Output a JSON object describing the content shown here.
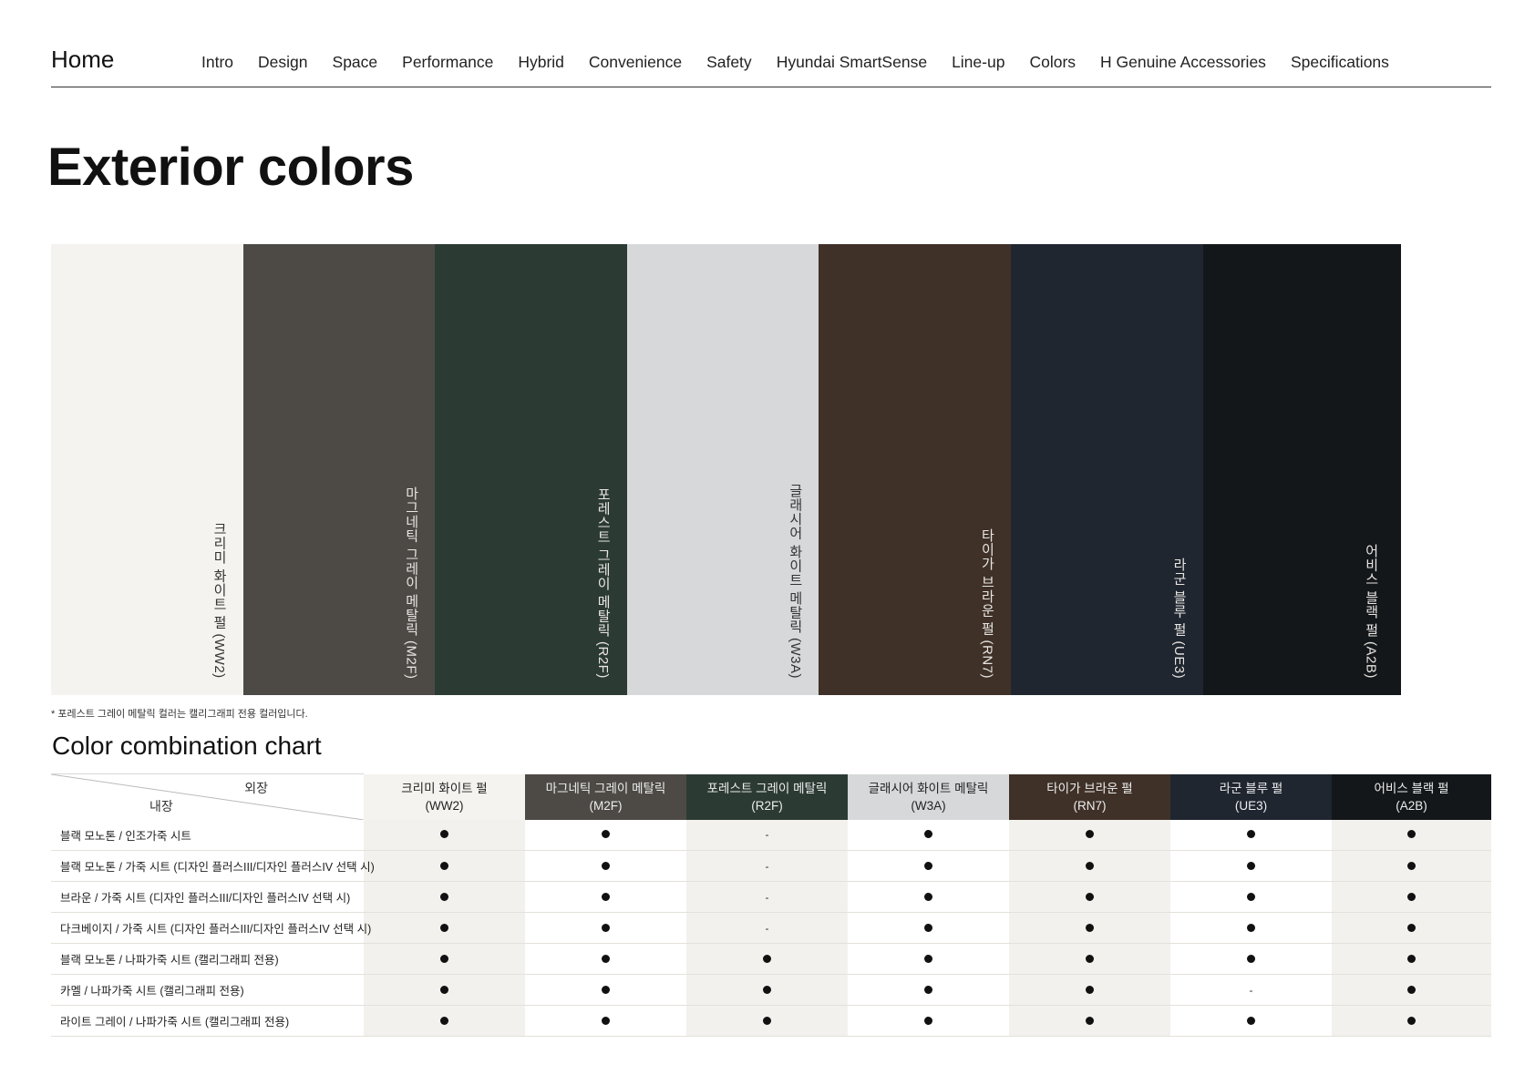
{
  "nav": {
    "home": "Home",
    "items": [
      "Intro",
      "Design",
      "Space",
      "Performance",
      "Hybrid",
      "Convenience",
      "Safety",
      "Hyundai SmartSense",
      "Line-up",
      "Colors",
      "H Genuine Accessories",
      "Specifications"
    ]
  },
  "title": "Exterior colors",
  "swatches": [
    {
      "label": "크리미 화이트 펄 (WW2)",
      "color": "#f4f3ef",
      "text_color": "#333333"
    },
    {
      "label": "마그네틱 그레이 메탈릭 (M2F)",
      "color": "#4d4a46",
      "text_color": "#e8e6e2"
    },
    {
      "label": "포레스트 그레이 메탈릭 (R2F)",
      "color": "#2c3a34",
      "text_color": "#e8e6e2"
    },
    {
      "label": "글래시어 화이트 메탈릭 (W3A)",
      "color": "#d6d8d9",
      "text_color": "#333333"
    },
    {
      "label": "타이가 브라운 펄 (RN7)",
      "color": "#3f3128",
      "text_color": "#e8e6e2"
    },
    {
      "label": "라군 블루 펄 (UE3)",
      "color": "#1f2630",
      "text_color": "#e8e6e2"
    },
    {
      "label": "어비스 블랙 펄 (A2B)",
      "color": "#13171a",
      "text_color": "#e8e6e2"
    }
  ],
  "footnote": "* 포레스트 그레이 메탈릭 컬러는 캘리그래피 전용 컬러입니다.",
  "chart": {
    "title": "Color combination chart",
    "corner_exterior": "외장",
    "corner_interior": "내장",
    "columns": [
      {
        "name": "크리미 화이트 펄",
        "code": "(WW2)",
        "bg": "#f4f3ef",
        "fg": "#222222",
        "shade": true
      },
      {
        "name": "마그네틱 그레이 메탈릭",
        "code": "(M2F)",
        "bg": "#4d4a46",
        "fg": "#eeeeee",
        "shade": false
      },
      {
        "name": "포레스트 그레이 메탈릭",
        "code": "(R2F)",
        "bg": "#2c3a34",
        "fg": "#eeeeee",
        "shade": true
      },
      {
        "name": "글래시어 화이트 메탈릭",
        "code": "(W3A)",
        "bg": "#d6d8d9",
        "fg": "#222222",
        "shade": false
      },
      {
        "name": "타이가 브라운 펄",
        "code": "(RN7)",
        "bg": "#3f3128",
        "fg": "#eeeeee",
        "shade": true
      },
      {
        "name": "라군 블루 펄",
        "code": "(UE3)",
        "bg": "#1f2630",
        "fg": "#eeeeee",
        "shade": false
      },
      {
        "name": "어비스 블랙 펄",
        "code": "(A2B)",
        "bg": "#13171a",
        "fg": "#eeeeee",
        "shade": true
      }
    ],
    "rows": [
      {
        "label": "블랙 모노톤 / 인조가죽 시트",
        "values": [
          "●",
          "●",
          "-",
          "●",
          "●",
          "●",
          "●"
        ]
      },
      {
        "label": "블랙 모노톤 / 가죽 시트 (디자인 플러스III/디자인 플러스IV 선택 시)",
        "values": [
          "●",
          "●",
          "-",
          "●",
          "●",
          "●",
          "●"
        ]
      },
      {
        "label": "브라운 / 가죽 시트 (디자인 플러스III/디자인 플러스IV 선택 시)",
        "values": [
          "●",
          "●",
          "-",
          "●",
          "●",
          "●",
          "●"
        ]
      },
      {
        "label": "다크베이지 / 가죽 시트 (디자인 플러스III/디자인 플러스IV 선택 시)",
        "values": [
          "●",
          "●",
          "-",
          "●",
          "●",
          "●",
          "●"
        ]
      },
      {
        "label": "블랙 모노톤 / 나파가죽 시트 (캘리그래피 전용)",
        "values": [
          "●",
          "●",
          "●",
          "●",
          "●",
          "●",
          "●"
        ]
      },
      {
        "label": "카멜 / 나파가죽 시트 (캘리그래피 전용)",
        "values": [
          "●",
          "●",
          "●",
          "●",
          "●",
          "-",
          "●"
        ]
      },
      {
        "label": "라이트 그레이 / 나파가죽 시트 (캘리그래피 전용)",
        "values": [
          "●",
          "●",
          "●",
          "●",
          "●",
          "●",
          "●"
        ]
      }
    ]
  }
}
